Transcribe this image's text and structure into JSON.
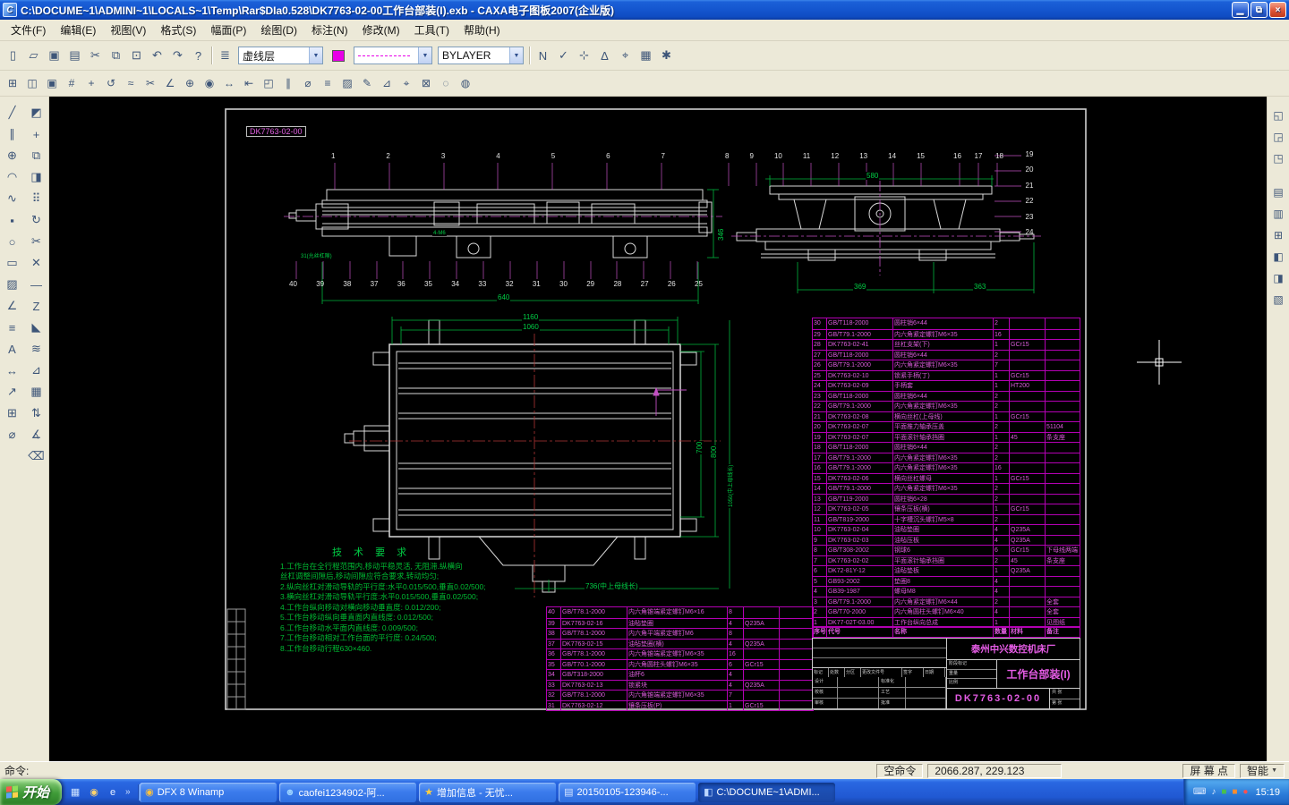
{
  "ui": {
    "arrow": "▼"
  },
  "window": {
    "title": "C:\\DOCUME~1\\ADMINI~1\\LOCALS~1\\Temp\\Rar$DIa0.528\\DK7763-02-00工作台部装(I).exb  -  CAXA电子图板2007(企业版)",
    "controls": {
      "min": "▁",
      "restore": "⧉",
      "close": "×"
    }
  },
  "menu": {
    "items": [
      "文件(F)",
      "编辑(E)",
      "视图(V)",
      "格式(S)",
      "幅面(P)",
      "绘图(D)",
      "标注(N)",
      "修改(M)",
      "工具(T)",
      "帮助(H)"
    ]
  },
  "toolbar1": {
    "std": [
      {
        "g": "▯",
        "n": "new-file-icon"
      },
      {
        "g": "▱",
        "n": "open-file-icon"
      },
      {
        "g": "▣",
        "n": "save-file-icon"
      },
      {
        "g": "▤",
        "n": "print-icon"
      },
      {
        "g": "✂",
        "n": "cut-icon"
      },
      {
        "g": "⧉",
        "n": "copy-icon"
      },
      {
        "g": "⊡",
        "n": "paste-icon"
      },
      {
        "g": "↶",
        "n": "undo-icon"
      },
      {
        "g": "↷",
        "n": "redo-icon"
      },
      {
        "g": "?",
        "n": "help-icon"
      }
    ],
    "layer_icon": "≣",
    "layer": "虚线层",
    "bylayer": "BYLAYER",
    "right": [
      {
        "g": "N",
        "n": "ortho-toggle-icon"
      },
      {
        "g": "✓",
        "n": "validate-icon"
      },
      {
        "g": "⊹",
        "n": "snap-icon"
      },
      {
        "g": "Δ",
        "n": "scale-icon"
      },
      {
        "g": "⌖",
        "n": "target-icon"
      },
      {
        "g": "▦",
        "n": "grid-icon"
      },
      {
        "g": "✱",
        "n": "settings-icon"
      }
    ]
  },
  "toolbar2": {
    "icons": [
      {
        "g": "⊞",
        "n": "frame-settings-icon"
      },
      {
        "g": "◫",
        "n": "paper-setup-icon"
      },
      {
        "g": "▣",
        "n": "titleblock-icon"
      },
      {
        "g": "#",
        "n": "grid-snap-icon"
      },
      {
        "g": "+",
        "n": "point-icon"
      },
      {
        "g": "↺",
        "n": "rotate-view-icon"
      },
      {
        "g": "≈",
        "n": "spline-icon"
      },
      {
        "g": "✂",
        "n": "trim-icon"
      },
      {
        "g": "∠",
        "n": "angle-dim-icon"
      },
      {
        "g": "⊕",
        "n": "circle-icon"
      },
      {
        "g": "◉",
        "n": "donut-icon"
      },
      {
        "g": "↔",
        "n": "linear-dim-icon"
      },
      {
        "g": "⇤",
        "n": "baseline-dim-icon"
      },
      {
        "g": "◰",
        "n": "zoom-window-icon"
      },
      {
        "g": "∥",
        "n": "parallel-icon"
      },
      {
        "g": "⌀",
        "n": "diameter-dim-icon"
      },
      {
        "g": "≡",
        "n": "layers-icon"
      },
      {
        "g": "▨",
        "n": "hatch-icon"
      },
      {
        "g": "✎",
        "n": "sketch-icon"
      },
      {
        "g": "⊿",
        "n": "chamfer-icon"
      },
      {
        "g": "⌖",
        "n": "center-mark-icon"
      },
      {
        "g": "⊠",
        "n": "erase-icon"
      },
      {
        "g": "◌",
        "n": "zoom-out-icon"
      },
      {
        "g": "◍",
        "n": "zoom-in-icon"
      }
    ]
  },
  "left_tools": {
    "col1": [
      {
        "g": "╱",
        "n": "line-tool-icon"
      },
      {
        "g": "∥",
        "n": "parallel-line-tool-icon"
      },
      {
        "g": "⊕",
        "n": "circle-tool-icon"
      },
      {
        "g": "◠",
        "n": "arc-tool-icon"
      },
      {
        "g": "∿",
        "n": "spline-tool-icon"
      },
      {
        "g": "▪",
        "n": "point-tool-icon"
      },
      {
        "g": "○",
        "n": "ellipse-tool-icon"
      },
      {
        "g": "▭",
        "n": "rectangle-tool-icon"
      },
      {
        "g": "▨",
        "n": "hatch-tool-icon"
      },
      {
        "g": "∠",
        "n": "polyline-tool-icon"
      },
      {
        "g": "≡",
        "n": "multiline-tool-icon"
      },
      {
        "g": "A",
        "n": "text-tool-icon"
      },
      {
        "g": "↔",
        "n": "dimension-tool-icon"
      },
      {
        "g": "↗",
        "n": "leader-tool-icon"
      },
      {
        "g": "⊞",
        "n": "block-tool-icon"
      },
      {
        "g": "⌀",
        "n": "diameter-tool-icon"
      }
    ],
    "col2": [
      {
        "g": "◩",
        "n": "fill-tool-icon"
      },
      {
        "g": "+",
        "n": "move-tool-icon"
      },
      {
        "g": "⧉",
        "n": "copy-entity-tool-icon"
      },
      {
        "g": "◨",
        "n": "mirror-tool-icon"
      },
      {
        "g": "⠿",
        "n": "array-tool-icon"
      },
      {
        "g": "↻",
        "n": "rotate-tool-icon"
      },
      {
        "g": "✂",
        "n": "trim-tool-icon"
      },
      {
        "g": "✕",
        "n": "delete-tool-icon"
      },
      {
        "g": "—",
        "n": "break-tool-icon"
      },
      {
        "g": "Z",
        "n": "zoom-tool-icon"
      },
      {
        "g": "◣",
        "n": "chamfer-tool-icon"
      },
      {
        "g": "≋",
        "n": "stretch-tool-icon"
      },
      {
        "g": "⊿",
        "n": "fillet-tool-icon"
      },
      {
        "g": "▦",
        "n": "grid-tool-icon"
      },
      {
        "g": "⇅",
        "n": "offset-tool-icon"
      },
      {
        "g": "∡",
        "n": "angle-tool-icon"
      },
      {
        "g": "⌫",
        "n": "undo-entity-tool-icon"
      }
    ]
  },
  "right_tools": [
    {
      "g": "◱",
      "n": "cascade-windows-icon"
    },
    {
      "g": "◲",
      "n": "tile-windows-icon"
    },
    {
      "g": "◳",
      "n": "arrange-windows-icon"
    },
    {
      "g": "▤",
      "n": "properties-panel-icon"
    },
    {
      "g": "▥",
      "n": "library-panel-icon"
    },
    {
      "g": "⊞",
      "n": "symbol-panel-icon"
    },
    {
      "g": "◧",
      "n": "layer-panel-icon"
    },
    {
      "g": "◨",
      "n": "style-panel-icon"
    },
    {
      "g": "▧",
      "n": "toolbox-panel-icon"
    }
  ],
  "drawing": {
    "frame_label": "DK7763-02-00",
    "callouts_top_left": [
      "1",
      "2",
      "3",
      "4",
      "5",
      "6",
      "7"
    ],
    "callouts_top_right_a": [
      "8",
      "9",
      "10",
      "11",
      "12",
      "13",
      "14",
      "15"
    ],
    "callouts_top_right_b": [
      "16",
      "17",
      "18"
    ],
    "callouts_right_col": [
      "19",
      "20",
      "21",
      "22",
      "23",
      "24"
    ],
    "callouts_bottom": [
      "40",
      "39",
      "38",
      "37",
      "36",
      "35",
      "34",
      "33",
      "32",
      "31",
      "30",
      "29",
      "28",
      "27",
      "26",
      "25"
    ],
    "dims": {
      "d580": "580",
      "d346": "346",
      "d640": "640",
      "d369": "369",
      "d363": "363",
      "d1160": "1160",
      "d1060": "1060",
      "d700": "700",
      "d800": "800",
      "d1050": "1050(中上母线长)",
      "d736": "736(中上母线长)",
      "d31": "31(允丝杠隙)",
      "m6": "4-M6"
    },
    "tech": {
      "title": "技 术 要 求",
      "lines": [
        "1.工作台在全行程范围内,移动平稳灵活, 无阻滞.纵横向",
        "  丝杠调整间隙后,移动间隙应符合要求,转动均匀;",
        "2.纵向丝杠对滑动导轨的平行度:水平0.015/500,垂直0.02/500;",
        "3.横向丝杠对滑动导轨平行度:水平0.015/500,垂直0.02/500;",
        "4.工作台纵向移动对横向移动垂直度: 0.012/200;",
        "5.工作台移动纵向垂直面内直线度: 0.012/500;",
        "6.工作台移动水平面内直线度: 0.009/500;",
        "7.工作台移动相对工作台面的平行度: 0.24/500;",
        "8.工作台移动行程630×460."
      ]
    },
    "bom_header": [
      "序号",
      "代号",
      "名称",
      "数量",
      "材料",
      "备注"
    ],
    "bom_right": [
      {
        "no": "30",
        "code": "GB/T118-2000",
        "name": "圆柱销6×44",
        "qty": "2",
        "mat": "",
        "note": ""
      },
      {
        "no": "29",
        "code": "GB/T79.1-2000",
        "name": "内六角紧定螺钉M6×35",
        "qty": "16",
        "mat": "",
        "note": ""
      },
      {
        "no": "28",
        "code": "DK7763-02-41",
        "name": "丝杠支架(下)",
        "qty": "1",
        "mat": "GCr15",
        "note": ""
      },
      {
        "no": "27",
        "code": "GB/T118-2000",
        "name": "圆柱销6×44",
        "qty": "2",
        "mat": "",
        "note": ""
      },
      {
        "no": "26",
        "code": "GB/T79.1-2000",
        "name": "内六角紧定螺钉M6×35",
        "qty": "7",
        "mat": "",
        "note": ""
      },
      {
        "no": "25",
        "code": "DK7763-02-10",
        "name": "锁紧手柄(丁)",
        "qty": "1",
        "mat": "GCr15",
        "note": ""
      },
      {
        "no": "24",
        "code": "DK7763-02-09",
        "name": "手柄套",
        "qty": "1",
        "mat": "HT200",
        "note": ""
      },
      {
        "no": "23",
        "code": "GB/T118-2000",
        "name": "圆柱销6×44",
        "qty": "2",
        "mat": "",
        "note": ""
      },
      {
        "no": "22",
        "code": "GB/T79.1-2000",
        "name": "内六角紧定螺钉M6×35",
        "qty": "2",
        "mat": "",
        "note": ""
      },
      {
        "no": "21",
        "code": "DK7763-02-08",
        "name": "横向丝杠(上母线)",
        "qty": "1",
        "mat": "GCr15",
        "note": ""
      },
      {
        "no": "20",
        "code": "DK7763-02-07",
        "name": "平面推力轴承压盖",
        "qty": "2",
        "mat": "",
        "note": "51104"
      },
      {
        "no": "19",
        "code": "DK7763-02-07",
        "name": "平面滚针轴承挡圈",
        "qty": "1",
        "mat": "45",
        "note": "条支座"
      },
      {
        "no": "18",
        "code": "GB/T118-2000",
        "name": "圆柱销6×44",
        "qty": "2",
        "mat": "",
        "note": ""
      },
      {
        "no": "17",
        "code": "GB/T79.1-2000",
        "name": "内六角紧定螺钉M6×35",
        "qty": "2",
        "mat": "",
        "note": ""
      },
      {
        "no": "16",
        "code": "GB/T79.1-2000",
        "name": "内六角紧定螺钉M6×35",
        "qty": "16",
        "mat": "",
        "note": ""
      },
      {
        "no": "15",
        "code": "DK7763-02-06",
        "name": "横向丝杠螺母",
        "qty": "1",
        "mat": "GCr15",
        "note": ""
      },
      {
        "no": "14",
        "code": "GB/T79.1-2000",
        "name": "内六角紧定螺钉M6×35",
        "qty": "2",
        "mat": "",
        "note": ""
      },
      {
        "no": "13",
        "code": "GB/T119-2000",
        "name": "圆柱销6×28",
        "qty": "2",
        "mat": "",
        "note": ""
      },
      {
        "no": "12",
        "code": "DK7763-02-05",
        "name": "镶条压板(横)",
        "qty": "1",
        "mat": "GCr15",
        "note": ""
      },
      {
        "no": "11",
        "code": "GB/T819-2000",
        "name": "十字槽沉头螺钉M5×8",
        "qty": "2",
        "mat": "",
        "note": ""
      },
      {
        "no": "10",
        "code": "DK7763-02-04",
        "name": "油毡垫圈",
        "qty": "4",
        "mat": "Q235A",
        "note": ""
      },
      {
        "no": "9",
        "code": "DK7763-02-03",
        "name": "油毡压板",
        "qty": "4",
        "mat": "Q235A",
        "note": ""
      },
      {
        "no": "8",
        "code": "GB/T308-2002",
        "name": "钢球6",
        "qty": "6",
        "mat": "GCr15",
        "note": "下母线两端"
      },
      {
        "no": "7",
        "code": "DK7763-02-02",
        "name": "平面滚针轴承挡圈",
        "qty": "2",
        "mat": "45",
        "note": "条支座"
      },
      {
        "no": "6",
        "code": "DK72-81Y-12",
        "name": "油毡垫板",
        "qty": "1",
        "mat": "Q235A",
        "note": ""
      },
      {
        "no": "5",
        "code": "GB93-2002",
        "name": "垫圈8",
        "qty": "4",
        "mat": "",
        "note": ""
      },
      {
        "no": "4",
        "code": "GB39-1987",
        "name": "螺母M8",
        "qty": "4",
        "mat": "",
        "note": ""
      },
      {
        "no": "3",
        "code": "GB/T79.1-2000",
        "name": "内六角紧定螺钉M6×44",
        "qty": "2",
        "mat": "",
        "note": "全套"
      },
      {
        "no": "2",
        "code": "GB/T70-2000",
        "name": "内六角圆柱头螺钉M6×40",
        "qty": "4",
        "mat": "",
        "note": "全套"
      },
      {
        "no": "1",
        "code": "DK77-02T-03.00",
        "name": "工作台纵向总成",
        "qty": "1",
        "mat": "",
        "note": "见图纸"
      }
    ],
    "bom_left": [
      {
        "no": "40",
        "code": "GB/T78.1-2000",
        "name": "内六角锥端紧定螺钉M6×16",
        "qty": "8",
        "mat": "",
        "note": ""
      },
      {
        "no": "39",
        "code": "DK7763-02-16",
        "name": "油毡垫圈",
        "qty": "4",
        "mat": "Q235A",
        "note": ""
      },
      {
        "no": "38",
        "code": "GB/T78.1-2000",
        "name": "内六角平端紧定螺钉M6",
        "qty": "8",
        "mat": "",
        "note": ""
      },
      {
        "no": "37",
        "code": "DK7763-02-15",
        "name": "油毡垫圈(横)",
        "qty": "4",
        "mat": "Q235A",
        "note": ""
      },
      {
        "no": "36",
        "code": "GB/T78.1-2000",
        "name": "内六角锥端紧定螺钉M6×35",
        "qty": "16",
        "mat": "",
        "note": ""
      },
      {
        "no": "35",
        "code": "GB/T70.1-2000",
        "name": "内六角圆柱头螺钉M6×35",
        "qty": "6",
        "mat": "GCr15",
        "note": ""
      },
      {
        "no": "34",
        "code": "GB/T318-2000",
        "name": "油杯6",
        "qty": "4",
        "mat": "",
        "note": ""
      },
      {
        "no": "33",
        "code": "DK7763-02-13",
        "name": "锁紧块",
        "qty": "4",
        "mat": "Q235A",
        "note": ""
      },
      {
        "no": "32",
        "code": "GB/T78.1-2000",
        "name": "内六角锥端紧定螺钉M6×35",
        "qty": "7",
        "mat": "",
        "note": ""
      },
      {
        "no": "31",
        "code": "DK7763-02-12",
        "name": "镶条压板(P)",
        "qty": "1",
        "mat": "GCr15",
        "note": ""
      }
    ],
    "titleblock": {
      "company": "泰州中兴数控机床厂",
      "title": "工作台部装(I)",
      "number": "DK7763-02-00",
      "cols": [
        "标记",
        "处数",
        "分区",
        "更改文件号",
        "签字",
        "日期"
      ],
      "roles": [
        "设计",
        "校核",
        "审核",
        "标准化",
        "工艺",
        "批准"
      ],
      "small": [
        "阶段标记",
        "重量",
        "比例",
        "共 张",
        "第 张"
      ]
    }
  },
  "statusbar": {
    "prompt": "命令:",
    "mode": "空命令",
    "coords": "2066.287, 229.123",
    "capture": "屏 幕 点",
    "smart": "智能"
  },
  "taskbar": {
    "start": "开始",
    "quick": [
      {
        "g": "▦",
        "n": "show-desktop-icon",
        "c": "#cfe4ff"
      },
      {
        "g": "◉",
        "n": "winamp-icon",
        "c": "#ffd36e"
      },
      {
        "g": "e",
        "n": "browser-icon",
        "c": "#e8f1ff"
      }
    ],
    "quick_more": "»",
    "buttons": [
      {
        "g": "◉",
        "c": "#ffc23e",
        "label": "DFX 8 Winamp"
      },
      {
        "g": "☻",
        "c": "#9ad1ff",
        "label": "caofei1234902-阿..."
      },
      {
        "g": "★",
        "c": "#ffcf3e",
        "label": "增加信息 - 无忧..."
      },
      {
        "g": "▤",
        "c": "#d8e6ff",
        "label": "20150105-123946-..."
      },
      {
        "g": "◧",
        "c": "#bcd7ff",
        "label": "C:\\DOCUME~1\\ADMI...",
        "active": true
      }
    ],
    "tray": [
      {
        "g": "⌨",
        "c": "#dce9ff",
        "n": "input-method-icon"
      },
      {
        "g": "♪",
        "c": "#dce9ff",
        "n": "volume-icon"
      },
      {
        "g": "■",
        "c": "#49c04c",
        "n": "antivirus-icon"
      },
      {
        "g": "■",
        "c": "#ff8c2e",
        "n": "download-icon"
      },
      {
        "g": "●",
        "c": "#ff5050",
        "n": "alert-icon"
      }
    ],
    "time": "15:19"
  }
}
